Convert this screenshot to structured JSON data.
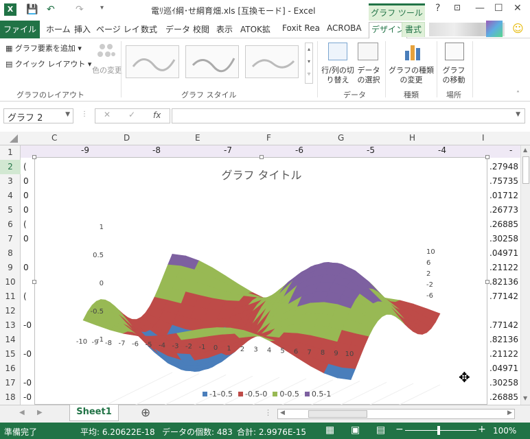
{
  "titlebar": {
    "filename": "電ﾘ巡ｲ綱･せ綱育畑.xls  [互換モード] - Excel",
    "context_tab_header": "グラフ ツール",
    "help": "?",
    "minimize": "—",
    "restore": "☐",
    "close": "✕"
  },
  "tabs": {
    "file": "ファイル",
    "items": [
      "ホーム",
      "挿入",
      "ページ レイ",
      "数式",
      "データ",
      "校閲",
      "表示",
      "ATOK拡",
      "Foxit Rea",
      "ACROBA"
    ],
    "design": "デザイン",
    "format": "書式"
  },
  "ribbon": {
    "add_element": "グラフ要素を追加",
    "quick_layout": "クイック レイアウト",
    "change_colors": "色の変更",
    "layout_group": "グラフのレイアウト",
    "styles_group": "グラフ スタイル",
    "switch_rowcol": "行/列の切り替え",
    "select_data": "データの選択",
    "data_group": "データ",
    "change_type": "グラフの種類の変更",
    "type_group": "種類",
    "move_chart": "グラフの移動",
    "location_group": "場所"
  },
  "formula_bar": {
    "name_box": "グラフ 2",
    "cancel": "✕",
    "enter": "✓",
    "fx": "fx",
    "value": ""
  },
  "grid": {
    "columns": [
      "C",
      "D",
      "E",
      "F",
      "G",
      "H",
      "I"
    ],
    "row1": [
      "-9",
      "-8",
      "-7",
      "-6",
      "-5",
      "-4",
      "-"
    ],
    "rows": [
      "1",
      "2",
      "3",
      "4",
      "5",
      "6",
      "7",
      "8",
      "9",
      "10",
      "11",
      "12",
      "13",
      "14",
      "15",
      "16",
      "17",
      "18"
    ],
    "left_cells": [
      "",
      "(",
      "0",
      "0",
      "0",
      "(",
      "0",
      "",
      "0",
      "",
      "(",
      "",
      "-0",
      "",
      "-0",
      "",
      "-0",
      "-0"
    ],
    "right_cells": [
      "",
      ".27948",
      ".75735",
      ".01712",
      ".26773",
      ".26885",
      ".30258",
      ".04971",
      ".21122",
      ".82136",
      ".77142",
      "",
      ".77142",
      ".82136",
      ".21122",
      ".04971",
      ".30258",
      ".26885"
    ]
  },
  "chart_data": {
    "type": "surface",
    "title": "グラフ タイトル",
    "x_ticks": [
      "-10",
      "-9",
      "-8",
      "-7",
      "-6",
      "-5",
      "-4",
      "-3",
      "-2",
      "-1",
      "0",
      "1",
      "2",
      "3",
      "4",
      "5",
      "6",
      "7",
      "8",
      "9",
      "10"
    ],
    "z_ticks": [
      "1",
      "0.5",
      "0",
      "-0.5",
      "-1"
    ],
    "y_ticks": [
      "10",
      "6",
      "2",
      "-2",
      "-6"
    ],
    "zlim": [
      -1,
      1
    ],
    "legend": [
      {
        "name": "-1–0.5",
        "color": "#4a7ebb"
      },
      {
        "name": "-0.5-0",
        "color": "#be4b48"
      },
      {
        "name": "0-0.5",
        "color": "#98b954"
      },
      {
        "name": "0.5-1",
        "color": "#7d60a0"
      }
    ]
  },
  "sheets": {
    "active": "Sheet1",
    "add": "⊕"
  },
  "status": {
    "ready": "準備完了",
    "average": "平均: 6.20622E-18",
    "count": "データの個数: 483",
    "sum": "合計: 2.9976E-15",
    "zoom": "100%"
  }
}
